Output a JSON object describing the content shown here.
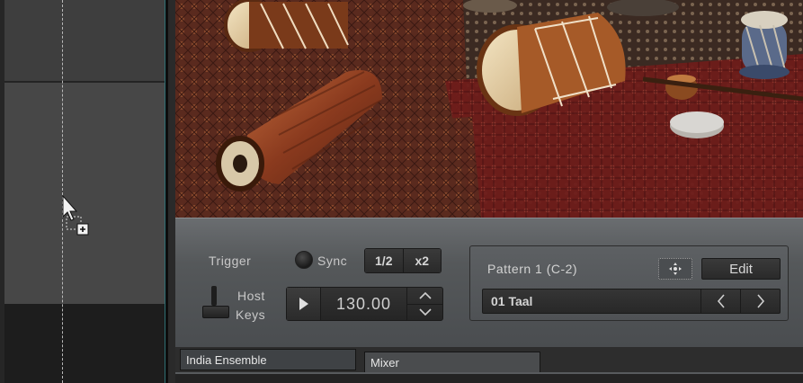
{
  "trigger": {
    "label": "Trigger"
  },
  "sync": {
    "label": "Sync"
  },
  "speed_buttons": [
    {
      "label": "1/2"
    },
    {
      "label": "x2"
    }
  ],
  "host_keys": {
    "line1": "Host",
    "line2": "Keys"
  },
  "tempo": {
    "value": "130.00"
  },
  "pattern": {
    "name": "Pattern 1 (C-2)",
    "edit_label": "Edit",
    "selected": "01 Taal"
  },
  "tabs": [
    {
      "label": "India Ensemble",
      "active": true
    },
    {
      "label": "Mixer",
      "active": false
    }
  ],
  "icons": {
    "cursor": "cursor-copy-icon",
    "play": "play-icon",
    "up": "chevron-up-icon",
    "down": "chevron-down-icon",
    "move": "move-icon",
    "prev": "chevron-left-icon",
    "next": "chevron-right-icon"
  }
}
